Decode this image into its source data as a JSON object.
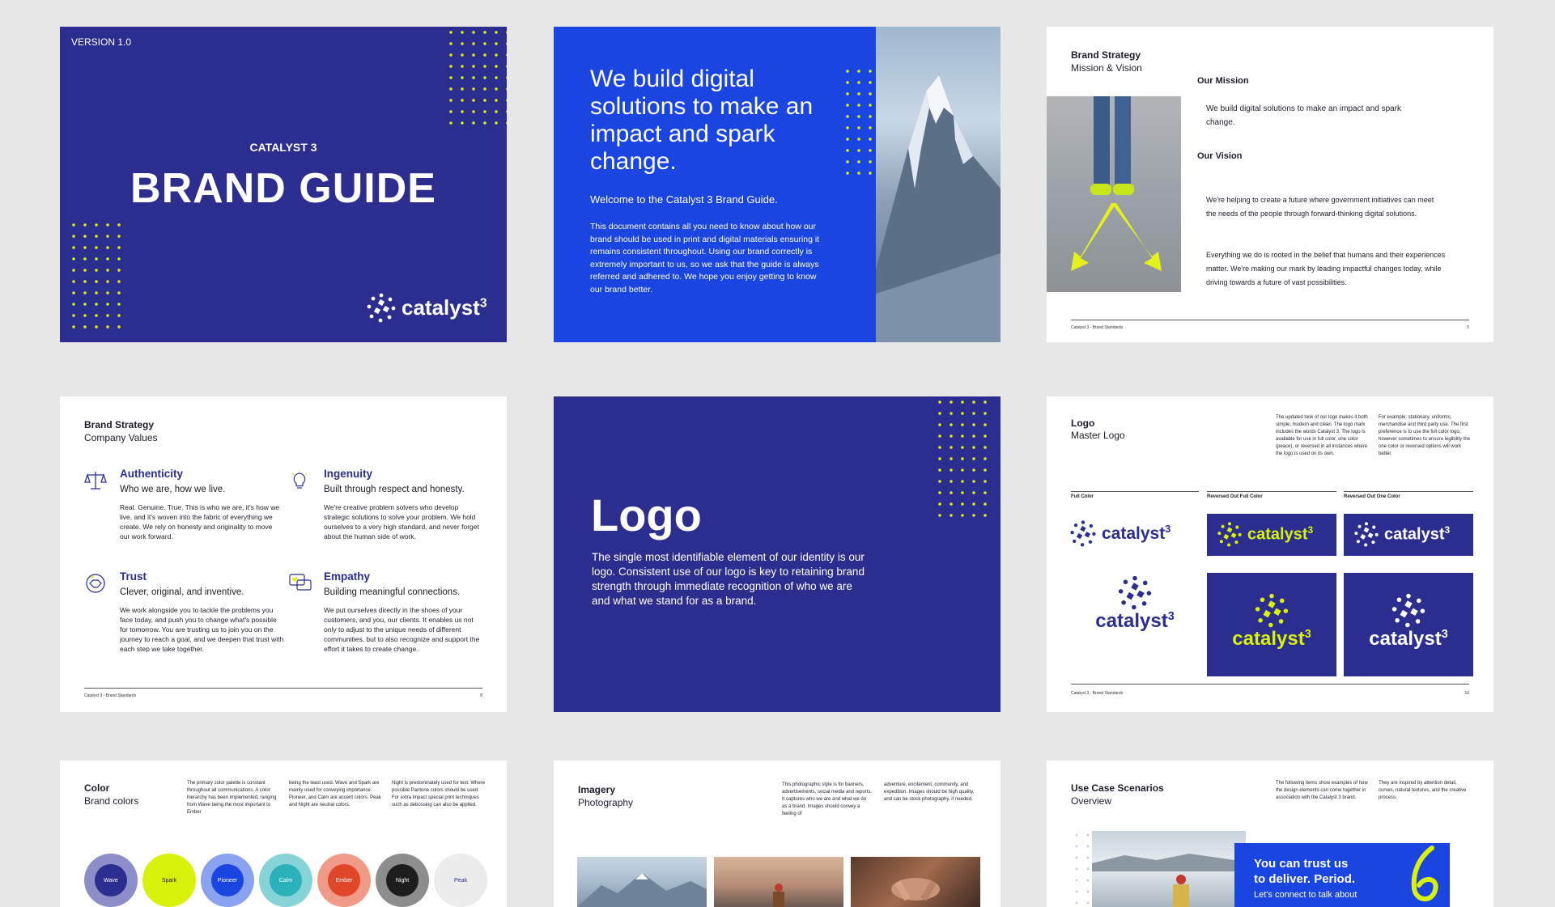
{
  "colors": {
    "navy": "#2b2e8f",
    "royal": "#1a45e0",
    "lime": "#d9f20a",
    "background": "#e7e7e8"
  },
  "slide1": {
    "version": "VERSION 1.0",
    "pretitle": "CATALYST 3",
    "title": "BRAND GUIDE",
    "logo_text": "catalyst",
    "logo_sup": "3"
  },
  "slide2": {
    "headline": "We build digital solutions to make an impact and spark change.",
    "welcome": "Welcome to the Catalyst 3 Brand Guide.",
    "body": "This document contains all you need to know about how our brand should be used in print and digital materials ensuring it remains consistent throughout. Using our brand correctly is extremely important to us, so we ask that the guide is always referred and adhered to. We hope you enjoy getting to know our brand better."
  },
  "slide3": {
    "section": "Brand Strategy",
    "subtitle": "Mission & Vision",
    "mission_heading": "Our Mission",
    "mission_text": "We build digital solutions to make an impact and spark change.",
    "vision_heading": "Our Vision",
    "vision_text_1": "We're helping to create a future where government initiatives can meet the needs of the people through forward-thinking digital solutions.",
    "vision_text_2": "Everything we do is rooted in the belief that humans and their experiences matter. We're making our mark by leading impactful changes today, while driving towards a future of vast possibilities.",
    "footer": "Catalyst 3 - Brand Standards",
    "page": "5"
  },
  "slide4": {
    "section": "Brand Strategy",
    "subtitle": "Company Values",
    "values": [
      {
        "title": "Authenticity",
        "tagline": "Who we are, how we live.",
        "body": "Real. Genuine. True. This is who we are, it's how we live, and it's woven into the fabric of everything we create. We rely on honesty and originality to move our work forward."
      },
      {
        "title": "Ingenuity",
        "tagline": "Built through respect and honesty.",
        "body": "We're creative problem solvers who develop strategic solutions to solve your problem. We hold ourselves to a very high standard, and never forget about the human side of work."
      },
      {
        "title": "Trust",
        "tagline": "Clever, original, and inventive.",
        "body": "We work alongside you to tackle the problems you face today, and push you to change what's possible for tomorrow. You are trusting us to join you on the journey to reach a goal, and we deepen that trust with each step we take together."
      },
      {
        "title": "Empathy",
        "tagline": "Building meaningful connections.",
        "body": "We put ourselves directly in the shoes of your customers, and you, our clients. It enables us not only to adjust to the unique needs of different communities, but to also recognize and support the effort it takes to create change."
      }
    ],
    "footer": "Catalyst 3 - Brand Standards",
    "page": "8"
  },
  "slide5": {
    "title": "Logo",
    "body": "The single most identifiable element of our identity is our logo. Consistent use of our logo is key to retaining brand strength through immediate recognition of who we are and what we stand for as a brand."
  },
  "slide6": {
    "section": "Logo",
    "subtitle": "Master Logo",
    "text_1": "The updated look of our logo makes it both simple, modern and clean. The logo mark includes the words Catalyst 3. The logo is available for use in full color, one color (peace), or reversed in all instances where the logo is used on its own.",
    "text_2": "For example: stationary, uniforms, merchandise and third party use. The first preference is to use the full color logo, however sometimes to ensure legibility the one color or reversed options will work better.",
    "label_full": "Full Color",
    "label_rev_full": "Reversed Out Full Color",
    "label_rev_one": "Reversed Out One Color",
    "logo_text": "catalyst",
    "logo_sup": "3",
    "footer": "Catalyst 3 - Brand Standards",
    "page": "10"
  },
  "slide7": {
    "section": "Color",
    "subtitle": "Brand colors",
    "text_1": "The primary color palette is constant throughout all communications. A color hierarchy has been implemented, ranging from Wave being the most important to Ember",
    "text_2": "being the least used. Wave and Spark are mainly used for conveying importance. Pioneer, and Calm are accent colors. Peak and Night are neutral colors.",
    "text_3": "Night is predominately used for text. Where possible Pantone colors should be used. For extra impact special print techniques such as debossing can also be applied.",
    "swatches": [
      {
        "name": "Wave",
        "outer": "#8c8ec9",
        "inner": "#2b2e8f",
        "text": "#ffffff"
      },
      {
        "name": "Spark",
        "outer": "#d9f20a",
        "inner": "#d9f20a",
        "text": "#1d1d2b"
      },
      {
        "name": "Pioneer",
        "outer": "#8aa3f0",
        "inner": "#1a45e0",
        "text": "#ffffff"
      },
      {
        "name": "Calm",
        "outer": "#86d4d7",
        "inner": "#2ab2b8",
        "text": "#ffffff"
      },
      {
        "name": "Ember",
        "outer": "#f09a87",
        "inner": "#e0462a",
        "text": "#ffffff"
      },
      {
        "name": "Night",
        "outer": "#8d8d8d",
        "inner": "#1d1d1d",
        "text": "#ffffff"
      },
      {
        "name": "Peak",
        "outer": "#ececec",
        "inner": "#ececec",
        "text": "#2b2e8f"
      }
    ]
  },
  "slide8": {
    "section": "Imagery",
    "subtitle": "Photography",
    "text_1": "This photographic style is for banners, advertisements, social media and reports. It captures who we are and what we do as a brand. Images should convey a feeling of",
    "text_2": "adventure, excitement, community, and expedition. Images should be high quality, and can be stock photography, if needed."
  },
  "slide9": {
    "section": "Use Case Scenarios",
    "subtitle": "Overview",
    "text_1": "The following items show examples of how the design elements can come together in association with the Catalyst 3 brand.",
    "text_2": "They are inspired by attention detail, curves, natural textures, and the creative process.",
    "card_title": "You can trust us to deliver. Period.",
    "card_sub": "Let's connect to talk about"
  }
}
